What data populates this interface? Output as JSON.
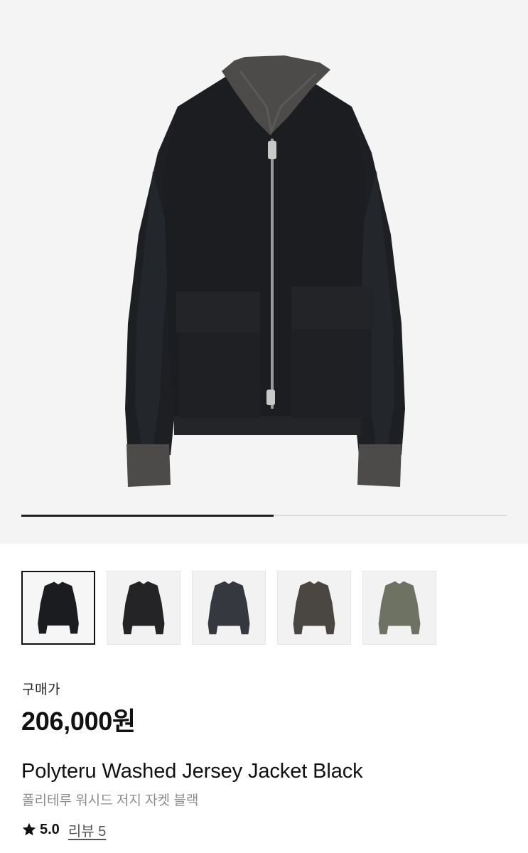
{
  "product": {
    "price_label": "구매가",
    "price": "206,000원",
    "name_en": "Polyteru Washed Jersey Jacket Black",
    "name_ko": "폴리테루 워시드 저지 자켓 블랙",
    "rating": "5.0",
    "reviews_label": "리뷰 5",
    "rating_icon": "star-icon"
  },
  "gallery": {
    "progress_fraction": 0.52,
    "selected_index": 0,
    "thumbnails": [
      {
        "color": "#1a1c1f",
        "name": "black"
      },
      {
        "color": "#242426",
        "name": "charcoal"
      },
      {
        "color": "#35383f",
        "name": "navy-grey"
      },
      {
        "color": "#4a4641",
        "name": "brown-grey"
      },
      {
        "color": "#6d7263",
        "name": "khaki"
      }
    ]
  },
  "colors": {
    "hero_background": "#f4f4f4",
    "jacket_body": "#1b1d20",
    "rib_trim": "#4c4b4a"
  }
}
